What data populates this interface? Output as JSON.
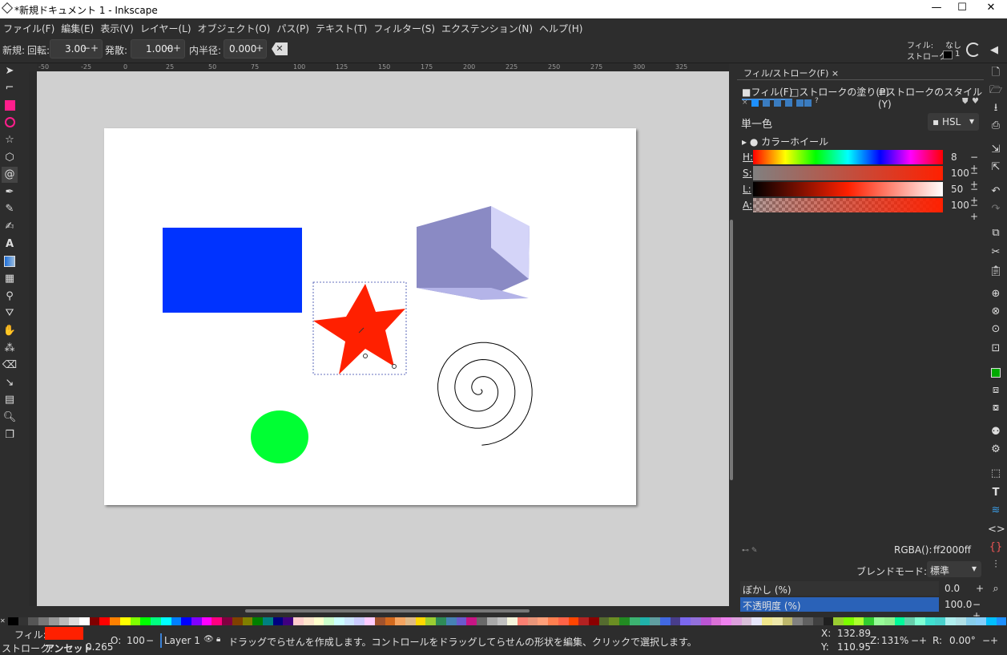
{
  "window": {
    "title": "*新規ドキュメント 1 - Inkscape",
    "min": "—",
    "max": "☐",
    "close": "✕"
  },
  "menu": [
    "ファイル(F)",
    "編集(E)",
    "表示(V)",
    "レイヤー(L)",
    "オブジェクト(O)",
    "パス(P)",
    "テキスト(T)",
    "フィルター(S)",
    "エクステンション(N)",
    "ヘルプ(H)"
  ],
  "toolcontrols": {
    "title": "新規:",
    "rotate_label": "回転:",
    "rotate_value": "3.00",
    "divergence_label": "発散:",
    "divergence_value": "1.000",
    "inner_radius_label": "内半径:",
    "inner_radius_value": "0.000",
    "pm": "−+",
    "fill_label": "フィル:",
    "fill_value": "なし",
    "stroke_label": "ストローク:",
    "stroke_value": "1"
  },
  "ruler": {
    "ticks": [
      "-50",
      "-25",
      "0",
      "25",
      "50",
      "75",
      "100",
      "125",
      "150",
      "175",
      "200",
      "225",
      "250",
      "275",
      "300",
      "325"
    ]
  },
  "panel": {
    "tab_title": "フィル/ストローク(F)",
    "tab_close": "×",
    "subtabs": [
      "フィル(F)",
      "ストロークの塗り(P)",
      "ストロークのスタイル(Y)"
    ],
    "paint_type": "単一色",
    "mode": "HSL",
    "color_wheel": "カラーホイール",
    "channels": [
      {
        "name": "H:",
        "value": "8"
      },
      {
        "name": "S:",
        "value": "100"
      },
      {
        "name": "L:",
        "value": "50"
      },
      {
        "name": "A:",
        "value": "100"
      }
    ],
    "rgba_label": "RGBA():",
    "rgba_value": "ff2000ff",
    "blend_label": "ブレンドモード:",
    "blend_value": "標準",
    "blur_label": "ぼかし (%)",
    "blur_value": "0.0",
    "opacity_label": "不透明度 (%)",
    "opacity_value": "100.0"
  },
  "status": {
    "fill_label": "フィル:",
    "stroke_label": "ストローク:",
    "stroke_value": "アンセット",
    "stroke_width": "0.265",
    "opacity_label": "O:",
    "opacity_value": "100",
    "layer": "Layer 1",
    "message": "ドラッグでらせんを作成します。コントロールをドラッグしてらせんの形状を編集、クリックで選択します。",
    "x_label": "X:",
    "x_value": "132.89",
    "y_label": "Y:",
    "y_value": "110.95",
    "z_label": "Z:",
    "zoom": "131%",
    "r_label": "R:",
    "rotation": "0.00°"
  },
  "colors": {
    "rect": "#0033ff",
    "star": "#ff2000",
    "ellipse": "#00ff33",
    "cube_top": "#8a8ac4",
    "cube_right": "#d4d4f8"
  },
  "palette": [
    "#000000",
    "#333333",
    "#555555",
    "#777777",
    "#999999",
    "#bbbbbb",
    "#dddddd",
    "#ffffff",
    "#800000",
    "#ff0000",
    "#ff8000",
    "#ffff00",
    "#80ff00",
    "#00ff00",
    "#00ff80",
    "#00ffff",
    "#0080ff",
    "#0000ff",
    "#8000ff",
    "#ff00ff",
    "#ff0080",
    "#800040",
    "#804000",
    "#808000",
    "#008000",
    "#008080",
    "#000080",
    "#400080",
    "#ffcccc",
    "#ffe5cc",
    "#ffffcc",
    "#ccffcc",
    "#ccffff",
    "#cce5ff",
    "#ccccff",
    "#ffccff",
    "#a0522d",
    "#d2691e",
    "#f4a460",
    "#deb887",
    "#ffd700",
    "#9acd32",
    "#2e8b57",
    "#4682b4",
    "#6a5acd",
    "#c71585",
    "#696969",
    "#a9a9a9",
    "#c0c0c0",
    "#f5f5dc",
    "#fa8072",
    "#e9967a",
    "#ffa07a",
    "#ff7f50",
    "#ff6347",
    "#ff4500",
    "#b22222",
    "#8b0000",
    "#556b2f",
    "#6b8e23",
    "#228b22",
    "#3cb371",
    "#20b2aa",
    "#5f9ea0",
    "#4169e1",
    "#483d8b",
    "#7b68ee",
    "#9370db",
    "#ba55d3",
    "#da70d6",
    "#ee82ee",
    "#dda0dd",
    "#d8bfd8",
    "#e6e6fa",
    "#f0e68c",
    "#eee8aa",
    "#bdb76b",
    "#808080",
    "#606060",
    "#404040",
    "#202020",
    "#9acd32",
    "#7cfc00",
    "#adff2f",
    "#32cd32",
    "#98fb98",
    "#90ee90",
    "#00fa9a",
    "#66cdaa",
    "#7fffd4",
    "#40e0d0",
    "#48d1cc",
    "#afeeee",
    "#b0e0e6",
    "#87ceeb",
    "#87cefa",
    "#00bfff",
    "#1e90ff"
  ]
}
